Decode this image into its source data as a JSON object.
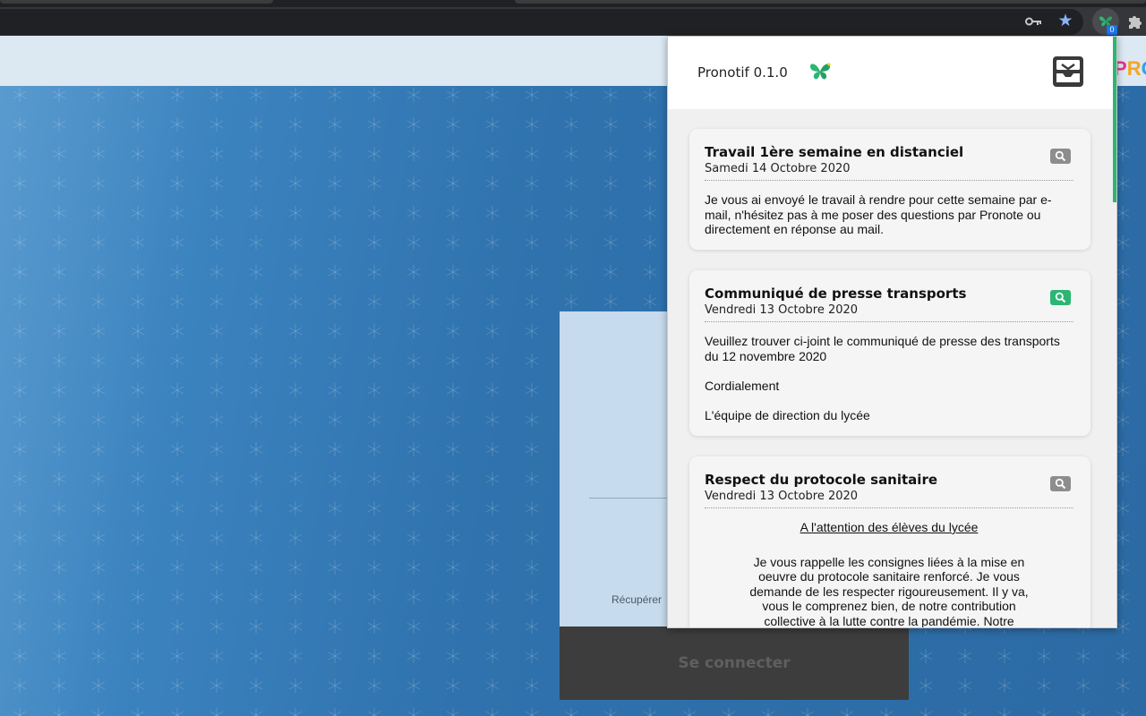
{
  "browser": {
    "extension_badge": "0"
  },
  "page": {
    "logo_letters": [
      "P",
      "R",
      "O"
    ],
    "recover_link": "Récupérer",
    "connect_button": "Se connecter"
  },
  "popup": {
    "title": "Pronotif 0.1.0",
    "accent_color": "#2bb673",
    "cards": [
      {
        "title": "Travail 1ère semaine en distanciel",
        "date": "Samedi 14 Octobre 2020",
        "magnify_state": "grey",
        "paragraphs": [
          "Je vous ai envoyé le travail à rendre pour cette semaine par e-mail, n'hésitez pas à me poser des questions par Pronote ou directement en réponse au mail."
        ]
      },
      {
        "title": "Communiqué de presse transports",
        "date": "Vendredi 13 Octobre 2020",
        "magnify_state": "green",
        "paragraphs": [
          "Veuillez trouver ci-joint le communiqué de presse des transports du 12 novembre 2020",
          "Cordialement",
          "L'équipe de direction du lycée"
        ]
      },
      {
        "title": "Respect du protocole sanitaire",
        "date": "Vendredi 13 Octobre 2020",
        "magnify_state": "grey",
        "heading": "A l'attention des élèves du lycée",
        "paragraphs": [
          "Je vous rappelle les consignes liées à la mise en oeuvre du protocole sanitaire renforcé. Je vous demande de les respecter rigoureusement. Il y va, vous le comprenez bien, de notre contribution collective à la lutte contre la pandémie. Notre responsabilité individuelle est engagée. Tous"
        ]
      }
    ]
  }
}
